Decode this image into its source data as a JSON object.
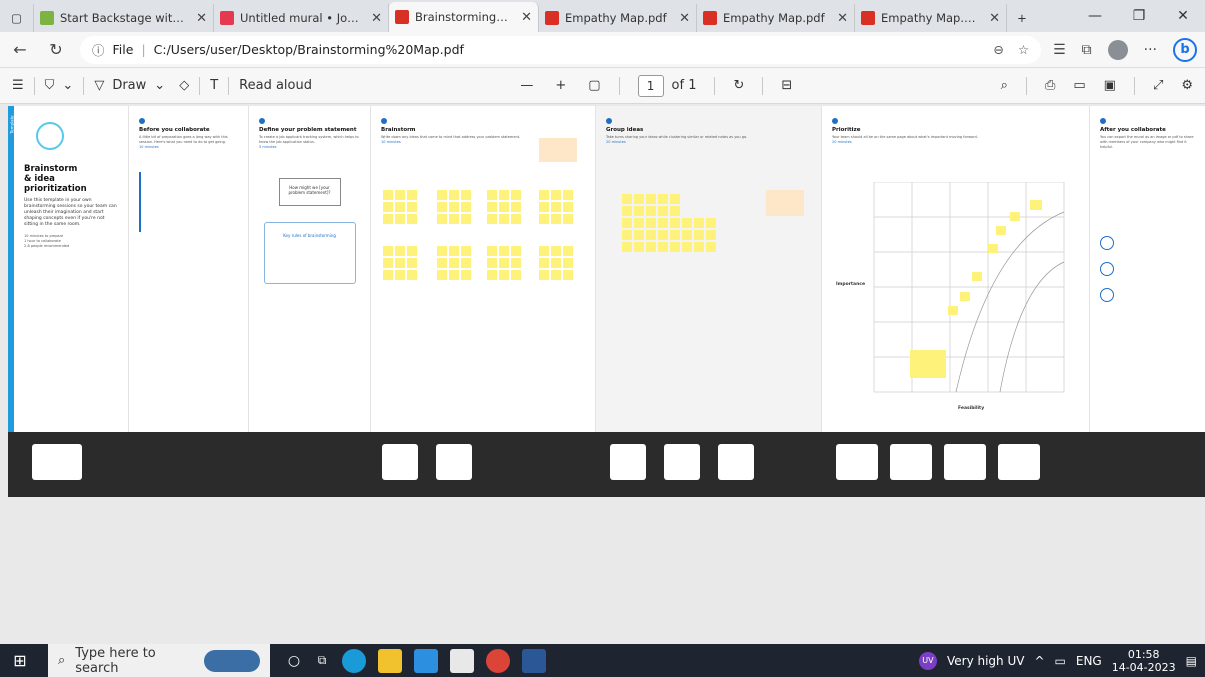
{
  "tabs": [
    {
      "title": "Start Backstage with th",
      "active": false,
      "fav": "#7cb342"
    },
    {
      "title": "Untitled mural • Job A",
      "active": false,
      "fav": "#e53950"
    },
    {
      "title": "Brainstorming Map.pd",
      "active": true,
      "fav": "#d93025"
    },
    {
      "title": "Empathy Map.pdf",
      "active": false,
      "fav": "#d93025"
    },
    {
      "title": "Empathy Map.pdf",
      "active": false,
      "fav": "#d93025"
    },
    {
      "title": "Empathy Map.pdf",
      "active": false,
      "fav": "#d93025"
    }
  ],
  "address": {
    "prefix": "File",
    "url": "C:/Users/user/Desktop/Brainstorming%20Map.pdf"
  },
  "pdf_toolbar": {
    "draw": "Draw",
    "read_aloud": "Read aloud",
    "page": "1",
    "of": "of 1"
  },
  "doc": {
    "sidebar_tab": "Template",
    "intro_title_1": "Brainstorm",
    "intro_title_2": "& idea prioritization",
    "intro_body": "Use this template in your own brainstorming sessions so your team can unleash their imagination and start shaping concepts even if you're not sitting in the same room.",
    "intro_items": [
      "10 minutes to prepare",
      "1 hour to collaborate",
      "2-8 people recommended"
    ],
    "panels": [
      {
        "title": "Before you collaborate",
        "body": "A little bit of preparation goes a long way with this session. Here's what you need to do to get going.",
        "time": "10 minutes"
      },
      {
        "title": "Define your problem statement",
        "body": "To create a job applicant tracking system, which helps to know the job application status.",
        "time": "5 minutes"
      },
      {
        "title": "Brainstorm",
        "body": "Write down any ideas that come to mind that address your problem statement.",
        "time": "10 minutes"
      },
      {
        "title": "Group ideas",
        "body": "Take turns sharing your ideas while clustering similar or related notes as you go.",
        "time": "20 minutes"
      },
      {
        "title": "Prioritize",
        "body": "Your team should all be on the same page about what's important moving forward.",
        "time": "20 minutes"
      },
      {
        "title": "After you collaborate",
        "body": "You can export the mural as an image or pdf to share with members of your company who might find it helpful."
      }
    ],
    "importance": "Importance",
    "feasibility": "Feasibility",
    "hmw": "How might we [your problem statement]?",
    "key_rules": "Key rules of brainstorming"
  },
  "taskbar": {
    "search_placeholder": "Type here to search",
    "weather": "Very high UV",
    "lang": "ENG",
    "time": "01:58",
    "date": "14-04-2023"
  }
}
